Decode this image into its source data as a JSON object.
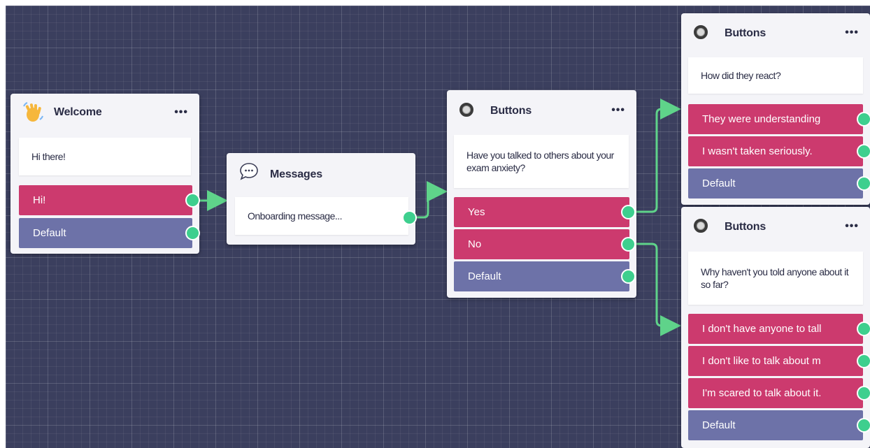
{
  "nodes": {
    "welcome": {
      "title": "Welcome",
      "icon": "waving-hand-icon",
      "message": "Hi there!",
      "buttons": [
        "Hi!"
      ],
      "default_label": "Default"
    },
    "messages": {
      "title": "Messages",
      "icon": "speech-bubble-icon",
      "message": "Onboarding message..."
    },
    "buttons_anxiety": {
      "title": "Buttons",
      "icon": "radio-icon",
      "message": "Have you talked to others about your exam anxiety?",
      "buttons": [
        "Yes",
        "No"
      ],
      "default_label": "Default"
    },
    "buttons_react": {
      "title": "Buttons",
      "icon": "radio-icon",
      "message": "How did they react?",
      "buttons": [
        "They were understanding",
        "I wasn't taken seriously."
      ],
      "default_label": "Default"
    },
    "buttons_why": {
      "title": "Buttons",
      "icon": "radio-icon",
      "message": "Why haven't you told anyone about it so far?",
      "buttons": [
        "I don't have anyone to tall",
        "I don't like to talk about m",
        "I'm scared to talk about it."
      ],
      "default_label": "Default"
    }
  },
  "more_menu_label": "•••",
  "colors": {
    "canvas": "#3b3f5e",
    "button_pink": "#cc3a6e",
    "button_default": "#6d72a8",
    "port_green": "#3ecf8e",
    "edge_green": "#5fd38a"
  }
}
